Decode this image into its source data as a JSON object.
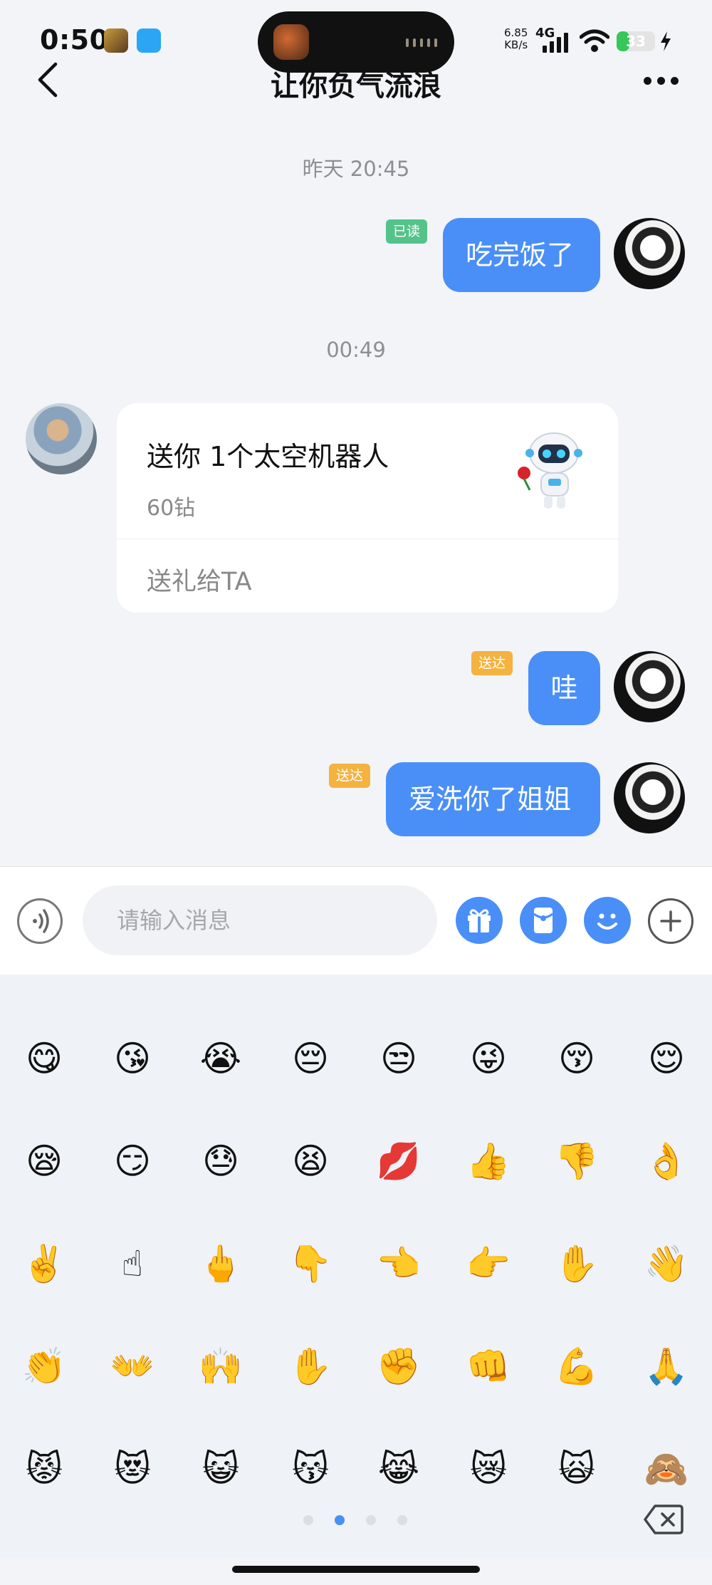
{
  "status_bar": {
    "time": "0:50",
    "net_speed": "6.85",
    "net_unit": "KB/s",
    "net_type": "4G",
    "battery": "33",
    "battery_level": 0.33
  },
  "header": {
    "title": "让你负气流浪"
  },
  "messages": {
    "ts1": "昨天 20:45",
    "m1_text": "吃完饭了",
    "m1_status": "已读",
    "ts2": "00:49",
    "gift_text": "送你 1个太空机器人",
    "gift_price": "60钻",
    "gift_action": "送礼给TA",
    "m3_text": "哇",
    "m3_status": "送达",
    "m4_text": "爱洗你了姐姐",
    "m4_status": "送达"
  },
  "input": {
    "placeholder": "请输入消息"
  },
  "emojis": [
    "😋",
    "😘",
    "😭",
    "😔",
    "😒",
    "😜",
    "😚",
    "😌",
    "😪",
    "😏",
    "😓",
    "😫",
    "💋",
    "👍",
    "👎",
    "👌",
    "✌️",
    "☝",
    "🖕",
    "👇",
    "👈",
    "👉",
    "✋",
    "👋",
    "👏",
    "👐",
    "🙌",
    "✋",
    "✊",
    "👊",
    "💪",
    "🙏",
    "😾",
    "😻",
    "😺",
    "😽",
    "😹",
    "😿",
    "🙀",
    "🙈"
  ],
  "emoji_page": {
    "total": 4,
    "current": 2
  },
  "colors": {
    "accent": "#4a8ff7",
    "read_badge": "#54c38a",
    "sent_badge": "#f4b23f"
  }
}
